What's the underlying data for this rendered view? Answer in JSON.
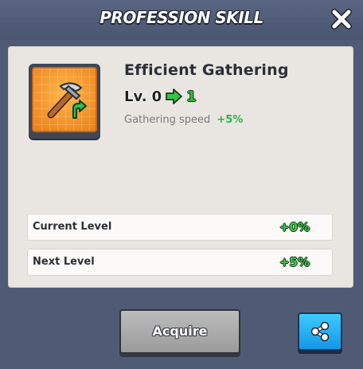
{
  "window": {
    "title": "PROFESSION SKILL",
    "close_icon": "close-icon"
  },
  "skill": {
    "name": "Efficient Gathering",
    "icon": "pickaxe-upgrade-icon",
    "level_label": "Lv.",
    "level_from": "0",
    "level_to": "1",
    "effect_label": "Gathering speed",
    "effect_value": "+5%"
  },
  "stats": [
    {
      "label": "Current Level",
      "value": "+0%"
    },
    {
      "label": "Next Level",
      "value": "+5%"
    }
  ],
  "actions": {
    "acquire_label": "Acquire",
    "share_icon": "share-icon"
  },
  "colors": {
    "background": "#4d5a74",
    "panel": "#e9e6e2",
    "positive": "#3ccd4a",
    "share_button": "#1fa9f0",
    "acquire_button": "#adadad",
    "icon_tile": "#f29a2a"
  }
}
